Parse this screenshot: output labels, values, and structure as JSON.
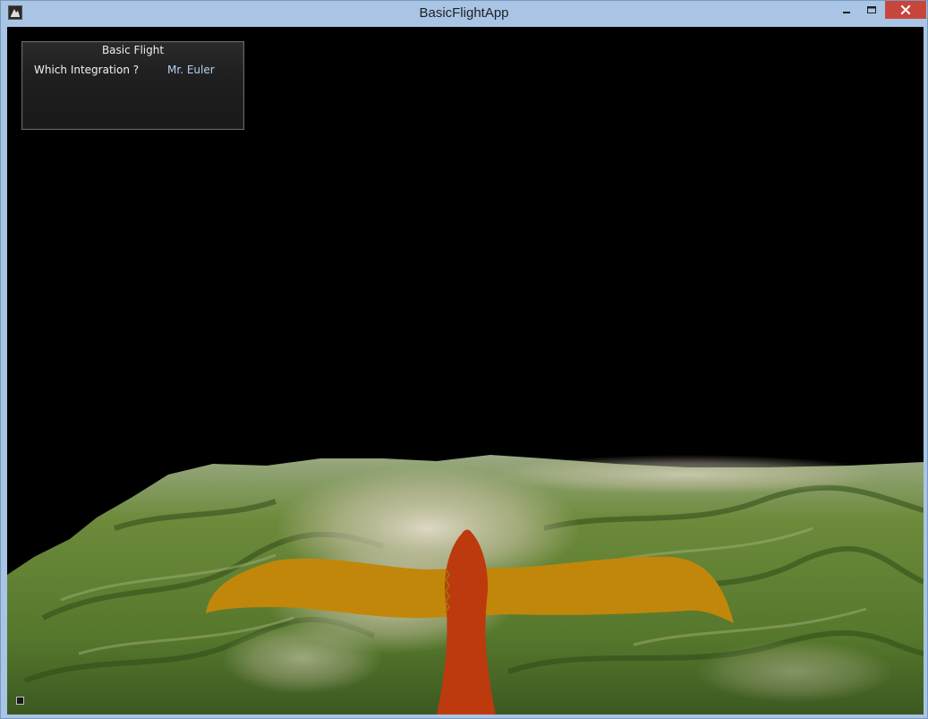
{
  "window": {
    "title": "BasicFlightApp",
    "icon": "app-logo-icon",
    "controls": {
      "minimize_icon": "minimize-icon",
      "maximize_icon": "maximize-icon",
      "close_icon": "close-icon",
      "close_color": "#c7463c"
    }
  },
  "hud": {
    "title": "Basic Flight",
    "label": "Which Integration ?",
    "value": "Mr. Euler"
  },
  "scene": {
    "sky_color": "#000000",
    "terrain_colors": [
      "#4f6e2a",
      "#7f9a4a",
      "#cfc9b2"
    ],
    "aircraft": {
      "wing_color": "#c1870a",
      "fuselage_color": "#bc3a0e"
    }
  },
  "status_icon": "help-icon"
}
